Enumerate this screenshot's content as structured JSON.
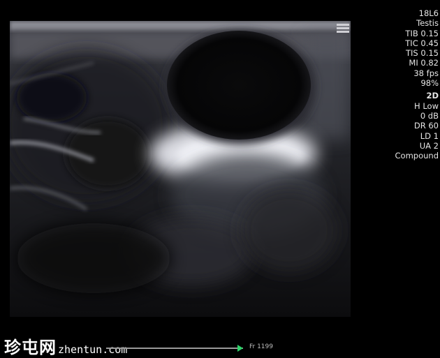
{
  "params": {
    "probe": "18L6",
    "preset": "Testis",
    "tib": "TIB 0.15",
    "tic": "TIC 0.45",
    "tis": "TIS 0.15",
    "mi": "MI 0.82",
    "fps": "38 fps",
    "power": "98%",
    "mode": "2D",
    "frequency": "H Low",
    "gain": "0 dB",
    "dynamic_range": "DR 60",
    "line_density": "LD 1",
    "ua": "UA 2",
    "compound": "Compound"
  },
  "watermark": {
    "chinese": "珍屯网",
    "url": "zhentun.com"
  },
  "cine": {
    "frame_label": "Fr 1199"
  },
  "colors": {
    "background": "#000000",
    "marker": "#2fd36a",
    "text": "#e6e6e6"
  }
}
